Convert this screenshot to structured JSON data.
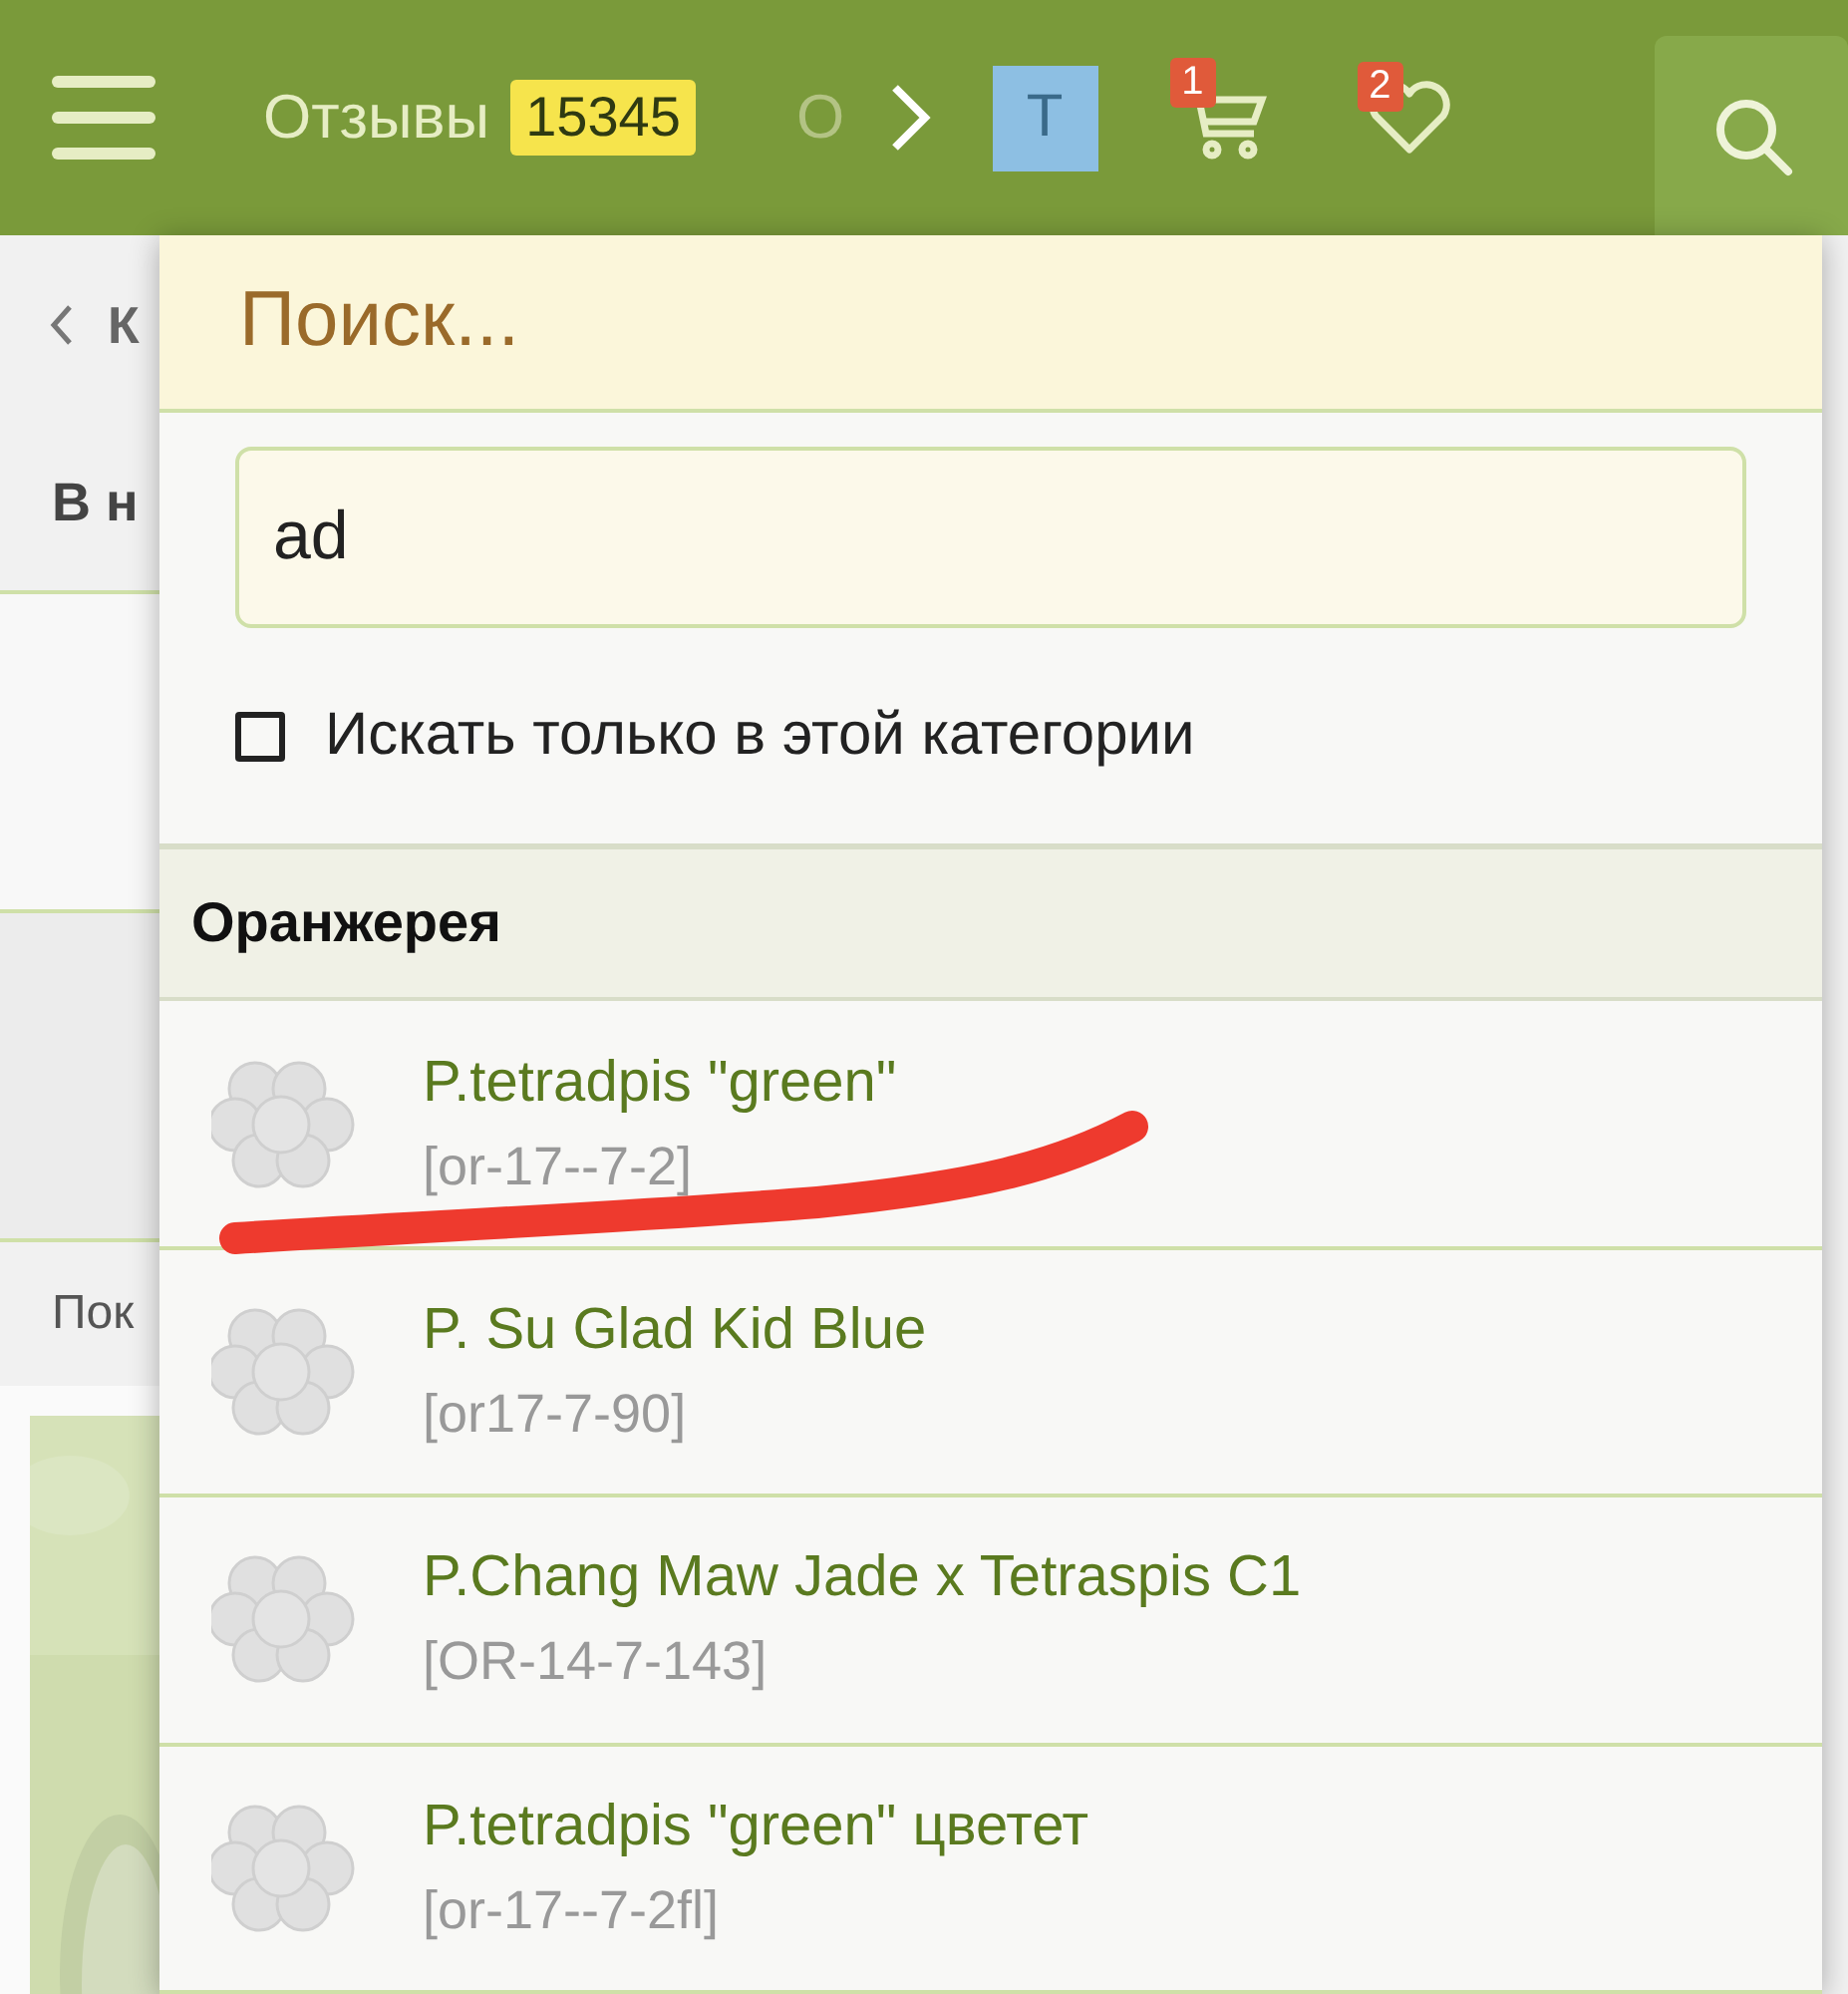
{
  "top_bar": {
    "reviews_label": "Отзывы",
    "reviews_count": "15345",
    "next_label": "О",
    "avatar_letter": "T",
    "cart_count": "1",
    "favorites_count": "2"
  },
  "background": {
    "breadcrumb": "К",
    "heading": "В н",
    "label": "Пок"
  },
  "search_panel": {
    "title": "Поиск...",
    "query": "ad",
    "only_category": {
      "label": "Искать только в этой категории",
      "checked": false
    },
    "group": {
      "name": "Оранжерея",
      "results": [
        {
          "title": "P.tetradpis \"green\"",
          "code": "[or-17--7-2]",
          "marked": true
        },
        {
          "title": "P. Su Glad Kid Blue",
          "code": "[or17-7-90]",
          "marked": false
        },
        {
          "title": "P.Chang Maw Jade x Tetraspis C1",
          "code": "[OR-14-7-143]",
          "marked": false
        },
        {
          "title": "P.tetradpis \"green\" цветет",
          "code": "[or-17--7-2fl]",
          "marked": false
        }
      ]
    }
  }
}
